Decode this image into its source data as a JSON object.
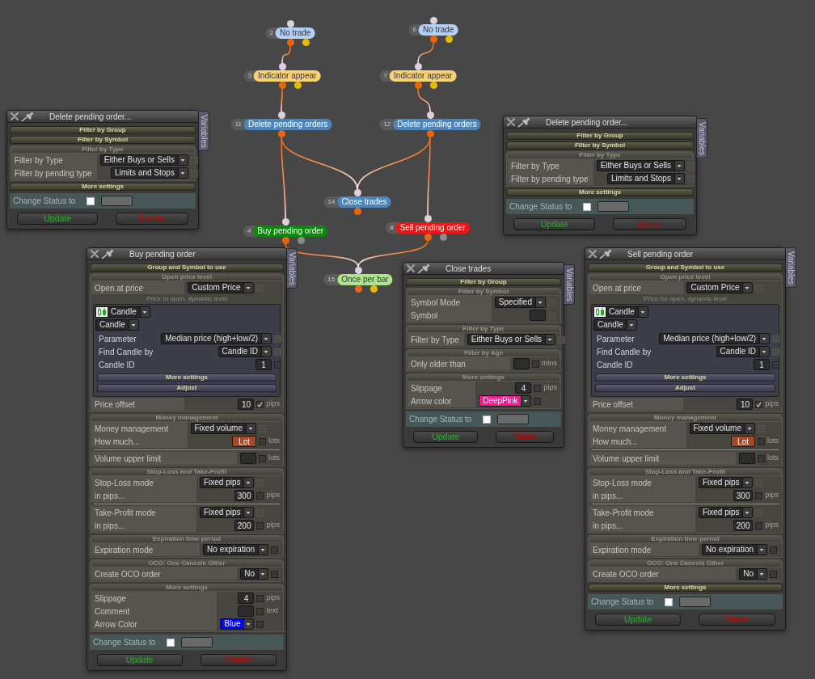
{
  "canvas": {
    "nodes": [
      {
        "number": "2",
        "label": "No trade",
        "color": "#b4d0f8",
        "outputs": [
          {
            "color": "#e8650e"
          },
          {
            "color": "#e4bd00"
          }
        ]
      },
      {
        "number": "6",
        "label": "No trade",
        "color": "#b4d0f8",
        "outputs": [
          {
            "color": "#e8650e"
          },
          {
            "color": "#e4bd00"
          }
        ]
      },
      {
        "number": "3",
        "label": "Indicator appear",
        "color": "#f8d274",
        "outputs": [
          {
            "color": "#e8650e"
          },
          {
            "color": "#e4bd00"
          }
        ]
      },
      {
        "number": "7",
        "label": "Indicator appear",
        "color": "#f8d274",
        "outputs": [
          {
            "color": "#e8650e"
          },
          {
            "color": "#e4bd00"
          }
        ]
      },
      {
        "number": "11",
        "label": "Delete pending orders",
        "color": "#4a86bd",
        "outputs": [
          {
            "color": "#e8650e"
          }
        ]
      },
      {
        "number": "12",
        "label": "Delete pending orders",
        "color": "#4a86bd",
        "outputs": [
          {
            "color": "#e8650e"
          }
        ]
      },
      {
        "number": "14",
        "label": "Close trades",
        "color": "#4a86bd",
        "outputs": [
          {
            "color": "#e8650e"
          }
        ]
      },
      {
        "number": "4",
        "label": "Buy pending order",
        "color": "#0c880c",
        "outputs": [
          {
            "color": "#e8650e"
          },
          {
            "color": "#8c8c8c"
          }
        ]
      },
      {
        "number": "8",
        "label": "Sell pending order",
        "color": "#f01414",
        "outputs": [
          {
            "color": "#e8650e"
          },
          {
            "color": "#8c8c8c"
          }
        ]
      },
      {
        "number": "15",
        "label": "Once per bar",
        "color": "#aee48e",
        "outputs": [
          {
            "color": "#e8650e"
          },
          {
            "color": "#e4bd00"
          }
        ]
      }
    ]
  },
  "windows": [
    {
      "title": "Delete pending order...",
      "side_tab": "Variables",
      "sections": [
        {
          "title": "Filter by Group",
          "expanded": false
        },
        {
          "title": "Filter by Symbol",
          "expanded": false
        },
        {
          "title": "Filter by Type",
          "expanded": true,
          "groups": [
            {
              "rows": [
                {
                  "kind": "select",
                  "label": "Filter by Type",
                  "value": "Either Buys or Sells",
                  "checkbox": {
                    "checked": false,
                    "disabled": true
                  }
                },
                {
                  "kind": "select",
                  "label": "Filter by pending type",
                  "value": "Limits and Stops",
                  "checkbox": {
                    "checked": false,
                    "disabled": true
                  }
                }
              ]
            }
          ]
        },
        {
          "title": "More settings",
          "expanded": false
        }
      ],
      "status": {
        "label": "Change Status to",
        "checked": false
      },
      "buttons": [
        {
          "label": "Update",
          "kind": "update"
        },
        {
          "label": "Delete",
          "kind": "delete"
        }
      ]
    },
    {
      "title": "Delete pending order...",
      "side_tab": "Variables",
      "sections": [
        {
          "title": "Filter by Group",
          "expanded": false
        },
        {
          "title": "Filter by Symbol",
          "expanded": false
        },
        {
          "title": "Filter by Type",
          "expanded": true,
          "groups": [
            {
              "rows": [
                {
                  "kind": "select",
                  "label": "Filter by Type",
                  "value": "Either Buys or Sells",
                  "checkbox": {
                    "checked": false,
                    "disabled": true
                  }
                },
                {
                  "kind": "select",
                  "label": "Filter by pending type",
                  "value": "Limits and Stops",
                  "checkbox": {
                    "checked": false,
                    "disabled": true
                  }
                }
              ]
            }
          ]
        },
        {
          "title": "More settings",
          "expanded": false
        }
      ],
      "status": {
        "label": "Change Status to",
        "checked": false
      },
      "buttons": [
        {
          "label": "Update",
          "kind": "update"
        },
        {
          "label": "Delete",
          "kind": "delete"
        }
      ]
    },
    {
      "title": "Buy pending order",
      "side_tab": "Variables",
      "sections": [
        {
          "title": "Group and Symbol to use",
          "expanded": false
        },
        {
          "title": "Open price level",
          "expanded": true,
          "groups": [
            {
              "rows": [
                {
                  "kind": "select",
                  "label": "Open at price",
                  "value": "Custom Price",
                  "checkbox": {
                    "checked": false,
                    "disabled": true
                  }
                },
                {
                  "kind": "note",
                  "text": "Price to open, dynamic level"
                },
                {
                  "kind": "box",
                  "rows": [
                    {
                      "kind": "icon_select",
                      "value": "Candle"
                    },
                    {
                      "kind": "select",
                      "value": "Candle"
                    },
                    {
                      "kind": "select",
                      "label": "Parameter",
                      "value": "Median price (high+low/2)",
                      "checkbox": {
                        "checked": false,
                        "disabled": true
                      }
                    },
                    {
                      "kind": "select",
                      "label": "Find Candle by",
                      "value": "Candle ID",
                      "checkbox": {
                        "checked": false,
                        "disabled": true
                      }
                    },
                    {
                      "kind": "input",
                      "label": "Candle ID",
                      "value": "1",
                      "checkbox": {
                        "checked": false,
                        "disabled": false
                      }
                    },
                    {
                      "kind": "header",
                      "title": "More settings",
                      "expanded": false
                    },
                    {
                      "kind": "header",
                      "title": "Adjust",
                      "expanded": false
                    }
                  ]
                },
                {
                  "kind": "input",
                  "label": "Price offset",
                  "value": "10",
                  "unit": "pips",
                  "checkbox": {
                    "checked": true,
                    "disabled": false
                  }
                }
              ]
            }
          ]
        },
        {
          "title": "Money management",
          "expanded": true,
          "groups": [
            {
              "rows": [
                {
                  "kind": "select",
                  "label": "Money management",
                  "value": "Fixed volume",
                  "checkbox": {
                    "checked": false,
                    "disabled": true
                  }
                },
                {
                  "kind": "input",
                  "label": "How much...",
                  "value": "Lot",
                  "color": "#a4482a",
                  "unit": "lots",
                  "checkbox": {
                    "checked": false,
                    "disabled": false
                  }
                }
              ]
            },
            {
              "rows": [
                {
                  "kind": "input",
                  "label": "Volume upper limit",
                  "unit": "lots",
                  "checkbox": {
                    "checked": false,
                    "disabled": false
                  }
                }
              ]
            }
          ]
        },
        {
          "title": "Stop-Loss and Take-Profit",
          "expanded": true,
          "groups": [
            {
              "rows": [
                {
                  "kind": "select",
                  "label": "Stop-Loss mode",
                  "value": "Fixed pips",
                  "checkbox": {
                    "checked": false,
                    "disabled": true
                  }
                },
                {
                  "kind": "input",
                  "label": "in pips...",
                  "value": "300",
                  "unit": "pips",
                  "checkbox": {
                    "checked": false,
                    "disabled": false
                  }
                }
              ]
            },
            {
              "rows": [
                {
                  "kind": "select",
                  "label": "Take-Profit mode",
                  "value": "Fixed pips",
                  "checkbox": {
                    "checked": false,
                    "disabled": true
                  }
                },
                {
                  "kind": "input",
                  "label": "in pips...",
                  "value": "200",
                  "unit": "pips",
                  "checkbox": {
                    "checked": false,
                    "disabled": false
                  }
                }
              ]
            }
          ]
        },
        {
          "title": "Expiration time period",
          "expanded": true,
          "groups": [
            {
              "rows": [
                {
                  "kind": "select",
                  "label": "Expiration mode",
                  "value": "No expiration",
                  "checkbox": {
                    "checked": false,
                    "disabled": false
                  }
                }
              ]
            }
          ]
        },
        {
          "title": "OCO: One Cancels Other",
          "expanded": true,
          "groups": [
            {
              "rows": [
                {
                  "kind": "select",
                  "label": "Create OCO order",
                  "value": "No",
                  "checkbox": {
                    "checked": false,
                    "disabled": false
                  }
                }
              ]
            }
          ]
        },
        {
          "title": "More settings",
          "expanded": true,
          "groups": [
            {
              "rows": [
                {
                  "kind": "input",
                  "label": "Slippage",
                  "value": "4",
                  "unit": "pips",
                  "checkbox": {
                    "checked": false,
                    "disabled": false
                  }
                },
                {
                  "kind": "input",
                  "label": "Comment",
                  "unit": "text",
                  "checkbox": {
                    "checked": false,
                    "disabled": false
                  }
                },
                {
                  "kind": "color_select",
                  "label": "Arrow Color",
                  "value": "Blue",
                  "color": "#0000ff",
                  "checkbox": {
                    "checked": false,
                    "disabled": false
                  }
                }
              ]
            }
          ]
        }
      ],
      "status": {
        "label": "Change Status to",
        "checked": false
      },
      "buttons": [
        {
          "label": "Update",
          "kind": "update"
        },
        {
          "label": "Delete",
          "kind": "delete"
        }
      ]
    },
    {
      "title": "Close trades",
      "side_tab": "Variables",
      "sections": [
        {
          "title": "Filter by Group",
          "expanded": false
        },
        {
          "title": "Filter by Symbol",
          "expanded": true,
          "groups": [
            {
              "rows": [
                {
                  "kind": "select",
                  "label": "Symbol Mode",
                  "value": "Specified",
                  "checkbox": {
                    "checked": false,
                    "disabled": true
                  }
                },
                {
                  "kind": "input",
                  "label": "Symbol",
                  "checkbox": {
                    "checked": false,
                    "disabled": true
                  }
                }
              ]
            }
          ]
        },
        {
          "title": "Filter by Type",
          "expanded": true,
          "groups": [
            {
              "rows": [
                {
                  "kind": "select",
                  "label": "Filter by Type",
                  "value": "Either Buys or Sells",
                  "checkbox": {
                    "checked": false,
                    "disabled": true
                  }
                }
              ]
            }
          ]
        },
        {
          "title": "Filter by Age",
          "expanded": true,
          "groups": [
            {
              "rows": [
                {
                  "kind": "input",
                  "label": "Only older than",
                  "unit": "mins",
                  "checkbox": {
                    "checked": false,
                    "disabled": false
                  }
                }
              ]
            }
          ]
        },
        {
          "title": "More settings",
          "expanded": true,
          "groups": [
            {
              "rows": [
                {
                  "kind": "input",
                  "label": "Slippage",
                  "value": "4",
                  "unit": "pips",
                  "checkbox": {
                    "checked": false,
                    "disabled": false
                  }
                },
                {
                  "kind": "color_select",
                  "label": "Arrow color",
                  "value": "DeepPink",
                  "color": "#ff1493",
                  "checkbox": {
                    "checked": false,
                    "disabled": false
                  }
                }
              ]
            }
          ]
        }
      ],
      "status": {
        "label": "Change Status to",
        "checked": false
      },
      "buttons": [
        {
          "label": "Update",
          "kind": "update"
        },
        {
          "label": "Delete",
          "kind": "delete"
        }
      ]
    },
    {
      "title": "Sell pending order",
      "side_tab": "Variables",
      "sections": [
        {
          "title": "Group and Symbol to use",
          "expanded": false
        },
        {
          "title": "Open price level",
          "expanded": true,
          "groups": [
            {
              "rows": [
                {
                  "kind": "select",
                  "label": "Open at price",
                  "value": "Custom Price",
                  "checkbox": {
                    "checked": false,
                    "disabled": true
                  }
                },
                {
                  "kind": "note",
                  "text": "Price for open, dynamic level"
                },
                {
                  "kind": "box",
                  "rows": [
                    {
                      "kind": "icon_select",
                      "value": "Candle"
                    },
                    {
                      "kind": "select",
                      "value": "Candle"
                    },
                    {
                      "kind": "select",
                      "label": "Parameter",
                      "value": "Median price (high+low/2)",
                      "checkbox": {
                        "checked": false,
                        "disabled": true
                      }
                    },
                    {
                      "kind": "select",
                      "label": "Find Candle by",
                      "value": "Candle ID",
                      "checkbox": {
                        "checked": false,
                        "disabled": true
                      }
                    },
                    {
                      "kind": "input",
                      "label": "Candle ID",
                      "value": "1",
                      "checkbox": {
                        "checked": false,
                        "disabled": false
                      }
                    },
                    {
                      "kind": "header",
                      "title": "More settings",
                      "expanded": false
                    },
                    {
                      "kind": "header",
                      "title": "Adjust",
                      "expanded": false
                    }
                  ]
                },
                {
                  "kind": "input",
                  "label": "Price offset",
                  "value": "10",
                  "unit": "pips",
                  "checkbox": {
                    "checked": true,
                    "disabled": false
                  }
                }
              ]
            }
          ]
        },
        {
          "title": "Money management",
          "expanded": true,
          "groups": [
            {
              "rows": [
                {
                  "kind": "select",
                  "label": "Money management",
                  "value": "Fixed volume",
                  "checkbox": {
                    "checked": false,
                    "disabled": true
                  }
                },
                {
                  "kind": "input",
                  "label": "How much...",
                  "value": "Lot",
                  "color": "#a4482a",
                  "unit": "lots",
                  "checkbox": {
                    "checked": false,
                    "disabled": false
                  }
                }
              ]
            },
            {
              "rows": [
                {
                  "kind": "input",
                  "label": "Volume upper limit",
                  "unit": "lots",
                  "checkbox": {
                    "checked": false,
                    "disabled": false
                  }
                }
              ]
            }
          ]
        },
        {
          "title": "Stop-Loss and Take-Profit",
          "expanded": true,
          "groups": [
            {
              "rows": [
                {
                  "kind": "select",
                  "label": "Stop-Loss mode",
                  "value": "Fixed pips",
                  "checkbox": {
                    "checked": false,
                    "disabled": true
                  }
                },
                {
                  "kind": "input",
                  "label": "in pips...",
                  "value": "300",
                  "unit": "pips",
                  "checkbox": {
                    "checked": false,
                    "disabled": false
                  }
                }
              ]
            },
            {
              "rows": [
                {
                  "kind": "select",
                  "label": "Take-Profit mode",
                  "value": "Fixed pips",
                  "checkbox": {
                    "checked": false,
                    "disabled": true
                  }
                },
                {
                  "kind": "input",
                  "label": "in pips...",
                  "value": "200",
                  "unit": "pips",
                  "checkbox": {
                    "checked": false,
                    "disabled": false
                  }
                }
              ]
            }
          ]
        },
        {
          "title": "Expiration time period",
          "expanded": true,
          "groups": [
            {
              "rows": [
                {
                  "kind": "select",
                  "label": "Expiration mode",
                  "value": "No expiration",
                  "checkbox": {
                    "checked": false,
                    "disabled": false
                  }
                }
              ]
            }
          ]
        },
        {
          "title": "OCO: One Cancels Other",
          "expanded": true,
          "groups": [
            {
              "rows": [
                {
                  "kind": "select",
                  "label": "Create OCO order",
                  "value": "No",
                  "checkbox": {
                    "checked": false,
                    "disabled": false
                  }
                }
              ]
            }
          ]
        },
        {
          "title": "More settings",
          "expanded": false
        }
      ],
      "status": {
        "label": "Change Status to",
        "checked": false
      },
      "buttons": [
        {
          "label": "Update",
          "kind": "update"
        },
        {
          "label": "Delete",
          "kind": "delete"
        }
      ]
    }
  ]
}
